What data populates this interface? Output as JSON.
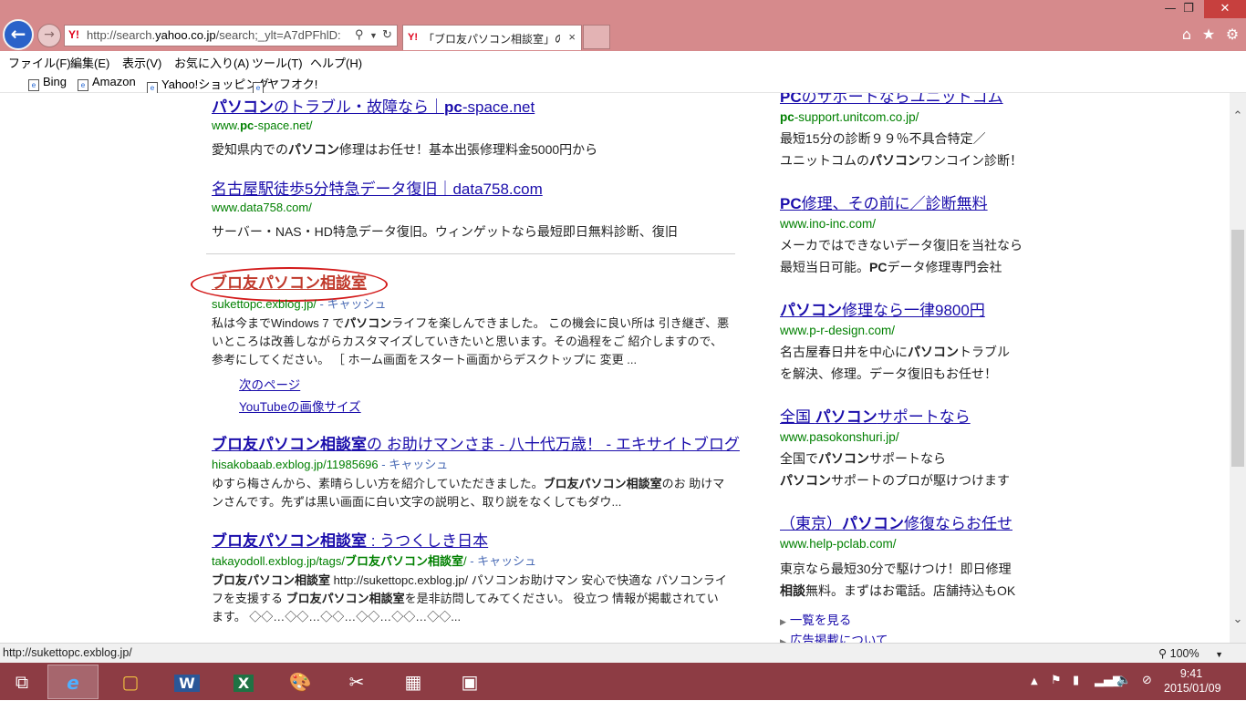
{
  "browser": {
    "address_url_prefix": "http://search.",
    "address_url_domain": "yahoo.co.jp",
    "address_url_rest": "/search;_ylt=A7dPFhlD:",
    "yahoo_logo": "Y!",
    "tab_title": "「ブロ友パソコン相談室」の検...",
    "tab_close": "×"
  },
  "menu": [
    "ファイル(F)",
    "編集(E)",
    "表示(V)",
    "お気に入り(A)",
    "ツール(T)",
    "ヘルプ(H)"
  ],
  "favorites": [
    "Bing",
    "Amazon",
    "Yahoo!ショッピング",
    "ヤフオク!"
  ],
  "results": {
    "top1": {
      "title_a": "パソコン",
      "title_b": "のトラブル・故障なら｜",
      "title_c": "pc",
      "title_d": "-space.net",
      "url_a": "www.",
      "url_b": "pc",
      "url_c": "-space.net/",
      "desc_a": "愛知県内での",
      "desc_b": "パソコン",
      "desc_c": "修理はお任せ！基本出張修理料金5000円から"
    },
    "top2": {
      "title": "名古屋駅徒歩5分特急データ復旧｜data758.com",
      "url": "www.data758.com/",
      "desc": "サーバー・NAS・HD特急データ復旧。ウィンゲットなら最短即日無料診断、復旧"
    },
    "main1": {
      "title": "ブロ友パソコン相談室",
      "url": "sukettopc.exblog.jp/",
      "cache": " - キャッシュ",
      "desc_a": "私は今までWindows 7 で",
      "desc_b": "パソコン",
      "desc_c": "ライフを楽しんできました。 この機会に良い所は 引き継ぎ、悪いところは改善しながらカスタマイズしていきたいと思います。その過程をご 紹介しますので、参考にしてください。 ［ ホーム画面をスタート画面からデスクトップに 変更 ...",
      "sublink1": "次のページ",
      "sublink2": "YouTubeの画像サイズ"
    },
    "main2": {
      "title_a": "ブロ友パソコン相談室",
      "title_b": "の お助けマンさま - 八十代万歳！ - エキサイトブログ",
      "url": "hisakobaab.exblog.jp/11985696",
      "cache": " - キャッシュ",
      "desc_a": "ゆすら梅さんから、素晴らしい方を紹介していただきました。",
      "desc_b": "ブロ友パソコン相談室",
      "desc_c": "のお 助けマンさんです。先ずは黒い画面に白い文字の説明と、取り説をなくしてもダウ..."
    },
    "main3": {
      "title_a": "ブロ友パソコン相談室",
      "title_b": " : うつくしき日本",
      "url_a": "takayodoll.exblog.jp/tags/",
      "url_b": "ブロ友パソコン相談室",
      "url_c": "/",
      "cache": " - キャッシュ",
      "desc_a": "ブロ友パソコン相談室",
      "desc_b": " http://sukettopc.exblog.jp/ パソコンお助けマン 安心で快適な パソコンライフを支援する ",
      "desc_c": "ブロ友パソコン相談室",
      "desc_d": "を是非訪問してみてください。 役立つ 情報が掲載されています。 ◇◇…◇◇…◇◇…◇◇…◇◇…◇◇..."
    }
  },
  "ads": {
    "a1": {
      "title_a": "PC",
      "title_b": "のサポートならユニットコム",
      "url_a": "pc",
      "url_b": "-support.unitcom.co.jp/",
      "desc1": "最短15分の診断９９％不具合特定／",
      "desc2_a": "ユニットコムの",
      "desc2_b": "パソコン",
      "desc2_c": "ワンコイン診断！"
    },
    "a2": {
      "title_a": "PC",
      "title_b": "修理、その前に／診断無料",
      "url": "www.ino-inc.com/",
      "desc1": "メーカではできないデータ復旧を当社なら",
      "desc2_a": "最短当日可能。",
      "desc2_b": "PC",
      "desc2_c": "データ修理専門会社"
    },
    "a3": {
      "title_a": "パソコン",
      "title_b": "修理なら一律9800円",
      "url": "www.p-r-design.com/",
      "desc1_a": "名古屋春日井を中心に",
      "desc1_b": "パソコン",
      "desc1_c": "トラブル",
      "desc2": "を解決、修理。データ復旧もお任せ！"
    },
    "a4": {
      "title_a": "全国 ",
      "title_b": "パソコン",
      "title_c": "サポートなら",
      "url": "www.pasokonshuri.jp/",
      "desc1_a": "全国で",
      "desc1_b": "パソコン",
      "desc1_c": "サポートなら",
      "desc2_a": "パソコン",
      "desc2_b": "サポートのプロが駆けつけます"
    },
    "a5": {
      "title_a": "（東京）",
      "title_b": "パソコン",
      "title_c": "修復ならお任せ",
      "url": "www.help-pclab.com/",
      "desc1": "東京なら最短30分で駆けつけ！即日修理",
      "desc2_a": "相談",
      "desc2_b": "無料。まずはお電話。店舗持込もOK"
    },
    "more1": "一覧を見る",
    "more2": "広告掲載について"
  },
  "status": {
    "url": "http://sukettopc.exblog.jp/",
    "zoom": "100%"
  },
  "clock": {
    "time": "9:41",
    "date": "2015/01/09"
  },
  "colors": {
    "titlebar": "#d68a8c",
    "taskbar": "#8d3c44",
    "link": "#1a0dab",
    "url_green": "#008000",
    "annotation_ring": "#d31a1a"
  }
}
